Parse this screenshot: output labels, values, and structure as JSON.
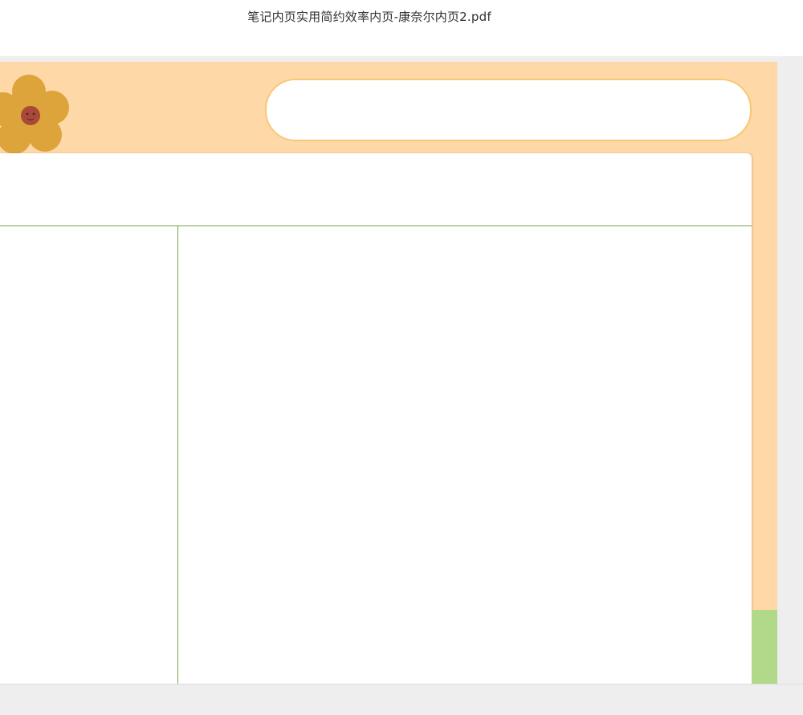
{
  "window": {
    "title": "笔记内页实用简约效率内页-康奈尔内页2.pdf"
  },
  "colors": {
    "page_background": "#fed8a6",
    "flower_petal": "#dda43b",
    "flower_center": "#a8493a",
    "rule_line": "#7aa247",
    "box_border": "#f7c878",
    "tab_green": "#b0da8a",
    "viewer_background": "#eeeeee"
  },
  "icons": {
    "flower": "flower-icon"
  }
}
